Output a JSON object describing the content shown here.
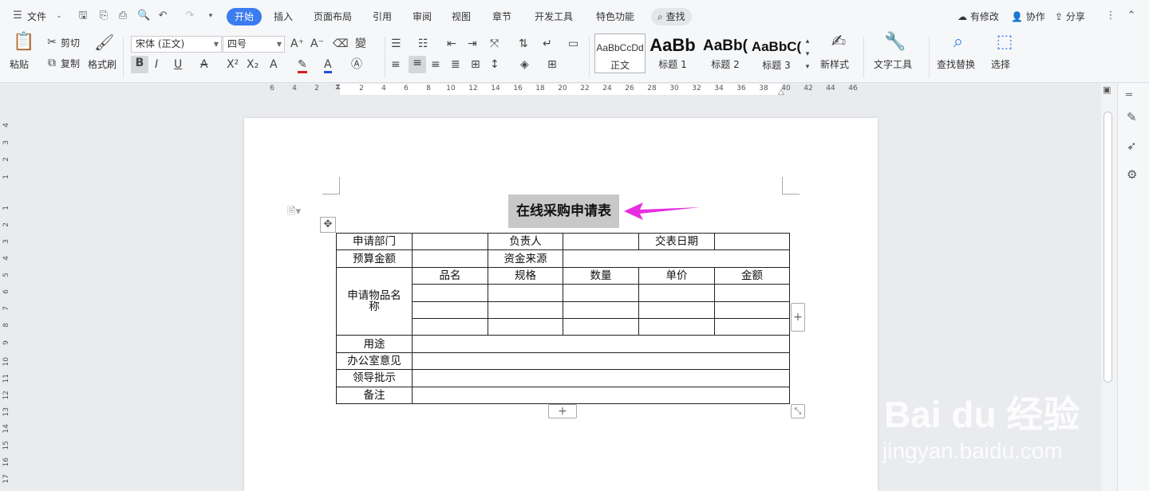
{
  "menubar": {
    "file_label": "文件",
    "tabs": [
      "开始",
      "插入",
      "页面布局",
      "引用",
      "审阅",
      "视图",
      "章节",
      "开发工具",
      "特色功能"
    ],
    "search_label": "查找",
    "modified_label": "有修改",
    "collab_label": "协作",
    "share_label": "分享"
  },
  "ribbon": {
    "paste": "粘贴",
    "cut": "剪切",
    "copy": "复制",
    "format_painter": "格式刷",
    "font_name": "宋体 (正文)",
    "font_size": "四号",
    "styles": [
      {
        "preview": "AaBbCcDd",
        "label": "正文"
      },
      {
        "preview": "AaBb",
        "label": "标题 1"
      },
      {
        "preview": "AaBb(",
        "label": "标题 2"
      },
      {
        "preview": "AaBbC(",
        "label": "标题 3"
      }
    ],
    "new_style": "新样式",
    "text_tools": "文字工具",
    "find_replace": "查找替换",
    "select": "选择"
  },
  "ruler": {
    "h_ticks": [
      "6",
      "4",
      "2",
      "2",
      "4",
      "6",
      "8",
      "10",
      "12",
      "14",
      "16",
      "18",
      "20",
      "22",
      "24",
      "26",
      "28",
      "30",
      "32",
      "34",
      "36",
      "38",
      "40",
      "42",
      "44",
      "46"
    ],
    "v_ticks": [
      "4",
      "3",
      "2",
      "1",
      "1",
      "2",
      "3",
      "4",
      "5",
      "6",
      "7",
      "8",
      "9",
      "10",
      "11",
      "12",
      "13",
      "14",
      "15",
      "16",
      "17"
    ]
  },
  "document": {
    "title": "在线采购申请表",
    "row1": [
      "申请部门",
      "",
      "负责人",
      "",
      "交表日期",
      ""
    ],
    "row2": [
      "预算金额",
      "",
      "资金来源",
      ""
    ],
    "items_label": "申请物品名称",
    "items_header": [
      "品名",
      "规格",
      "数量",
      "单价",
      "金额"
    ],
    "rows_bottom": [
      "用途",
      "办公室意见",
      "领导批示",
      "备注"
    ]
  },
  "annotation": {
    "arrow_color": "#e62ee0"
  },
  "watermark": {
    "text": "Bai du 经验",
    "url": "jingyan.baidu.com"
  },
  "colors": {
    "accent": "#3b7cf0"
  }
}
